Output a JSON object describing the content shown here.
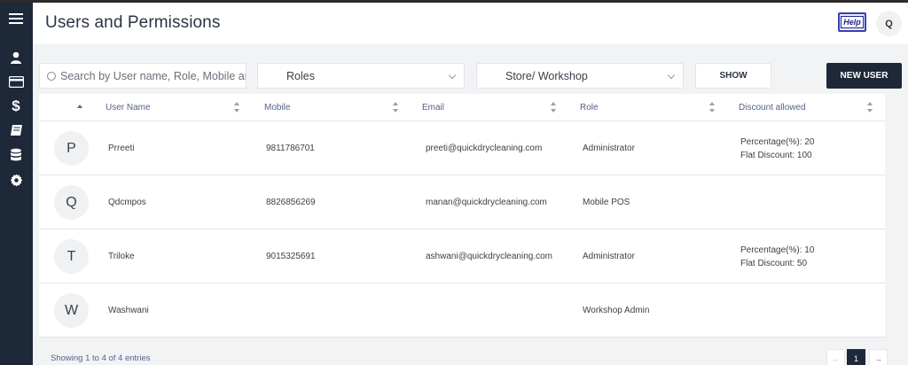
{
  "header": {
    "title": "Users and Permissions",
    "help_label": "Help",
    "user_initial": "Q"
  },
  "sidebar": {
    "items": [
      {
        "icon": "menu-icon"
      },
      {
        "icon": "user-icon"
      },
      {
        "icon": "credit-card-icon"
      },
      {
        "icon": "dollar-icon"
      },
      {
        "icon": "book-icon"
      },
      {
        "icon": "database-icon"
      },
      {
        "icon": "gear-icon"
      }
    ]
  },
  "filters": {
    "search_placeholder": "Search by User name, Role, Mobile an",
    "roles_label": "Roles",
    "store_label": "Store/ Workshop",
    "show_label": "SHOW",
    "new_user_label": "NEW USER"
  },
  "table": {
    "columns": [
      "User Name",
      "Mobile",
      "Email",
      "Role",
      "Discount allowed"
    ],
    "rows": [
      {
        "initial": "P",
        "name": "Prreeti",
        "mobile": "9811786701",
        "email": "preeti@quickdrycleaning.com",
        "role": "Administrator",
        "discount_pct": "Percentage(%): 20",
        "discount_flat": "Flat Discount: 100"
      },
      {
        "initial": "Q",
        "name": "Qdcmpos",
        "mobile": "8826856269",
        "email": "manan@quickdrycleaning.com",
        "role": "Mobile POS",
        "discount_pct": "",
        "discount_flat": ""
      },
      {
        "initial": "T",
        "name": "Triloke",
        "mobile": "9015325691",
        "email": "ashwani@quickdrycleaning.com",
        "role": "Administrator",
        "discount_pct": "Percentage(%): 10",
        "discount_flat": "Flat Discount: 50"
      },
      {
        "initial": "W",
        "name": "Washwani",
        "mobile": "",
        "email": "",
        "role": "Workshop Admin",
        "discount_pct": "",
        "discount_flat": ""
      }
    ]
  },
  "footer": {
    "showing": "Showing 1 to 4 of 4 entries",
    "pager_prev": "←",
    "current_page": "1",
    "pager_next": "→"
  },
  "colors": {
    "sidebar": "#1d2838",
    "primary_button": "#1d2838",
    "background": "#f2f3f5"
  }
}
